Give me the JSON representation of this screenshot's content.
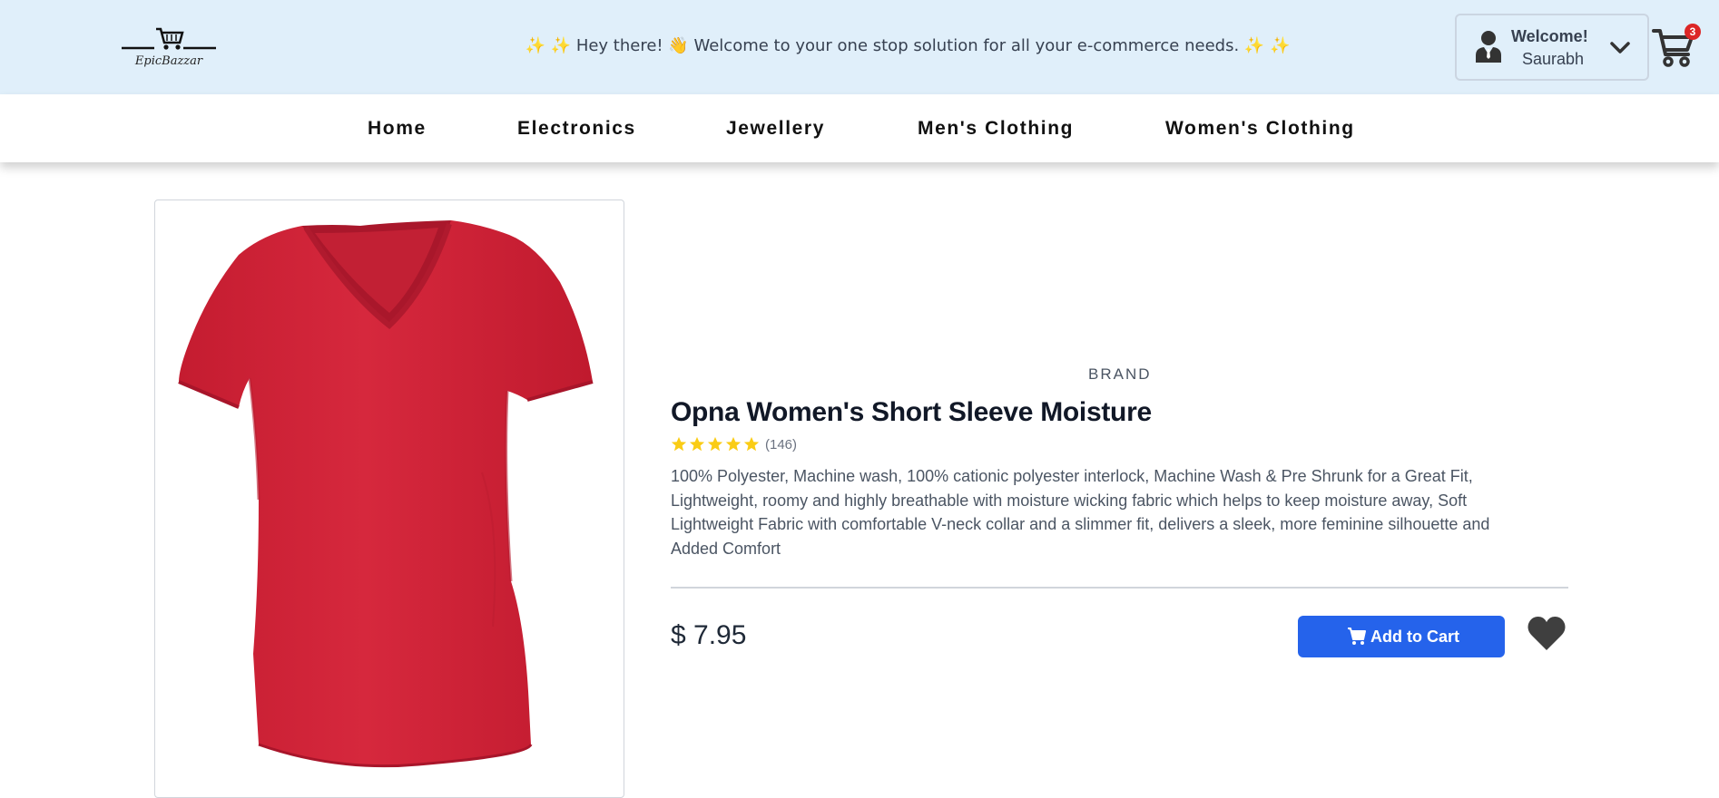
{
  "header": {
    "logo_text": "EpicBazzar",
    "greeting": "✨ ✨ Hey there! 👋 Welcome to your one stop solution for all your e-commerce needs. ✨ ✨",
    "welcome_label": "Welcome!",
    "user_name": "Saurabh",
    "cart_count": "3",
    "icons": [
      "shopping-cart-icon",
      "user-icon",
      "chevron-down-icon"
    ]
  },
  "nav": {
    "items": [
      {
        "label": "Home"
      },
      {
        "label": "Electronics"
      },
      {
        "label": "Jewellery"
      },
      {
        "label": "Men's Clothing"
      },
      {
        "label": "Women's Clothing"
      }
    ]
  },
  "product": {
    "brand": "BRAND",
    "title": "Opna Women's Short Sleeve Moisture",
    "rating_stars": 5,
    "rating_count": "(146)",
    "description": "100% Polyester, Machine wash, 100% cationic polyester interlock, Machine Wash & Pre Shrunk for a Great Fit, Lightweight, roomy and highly breathable with moisture wicking fabric which helps to keep moisture away, Soft Lightweight Fabric with comfortable V-neck collar and a slimmer fit, delivers a sleek, more feminine silhouette and Added Comfort",
    "price": "$ 7.95",
    "add_to_cart_label": "Add to Cart",
    "image_name": "red-v-neck-tshirt"
  },
  "colors": {
    "banner_bg": "#e0effa",
    "button_blue": "#2563eb",
    "star_yellow": "#facc15",
    "badge_red": "#dc2626",
    "shirt_red": "#d0263a"
  }
}
